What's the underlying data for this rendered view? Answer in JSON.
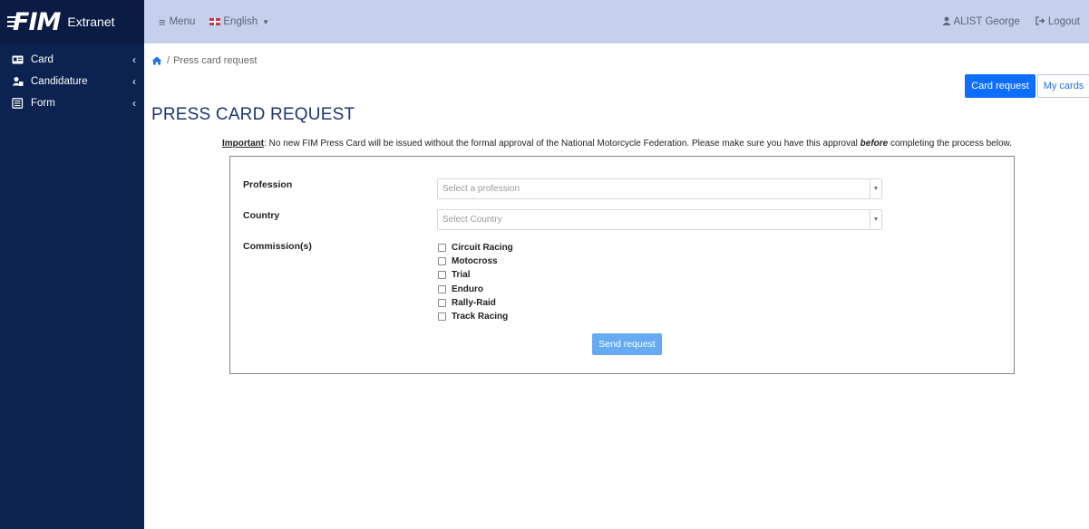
{
  "brand": {
    "logo": "FIM",
    "name": "Extranet"
  },
  "sidebar": {
    "items": [
      {
        "label": "Card",
        "icon": "id-card-icon"
      },
      {
        "label": "Candidature",
        "icon": "user-card-icon"
      },
      {
        "label": "Form",
        "icon": "form-list-icon"
      }
    ]
  },
  "topbar": {
    "menu_label": "Menu",
    "language_label": "English",
    "user_name": "ALIST George",
    "logout_label": "Logout"
  },
  "breadcrumb": {
    "separator": "/",
    "current": "Press card request"
  },
  "actions": {
    "card_request": "Card request",
    "my_cards": "My cards"
  },
  "page": {
    "title": "PRESS CARD REQUEST"
  },
  "notice": {
    "important": "Important",
    "text_before": ": No new FIM Press Card will be issued without the formal approval of the National Motorcycle Federation. Please make sure you have this approval ",
    "emphasis": "before",
    "text_after": " completing the process below."
  },
  "form": {
    "profession": {
      "label": "Profession",
      "placeholder": "Select a profession"
    },
    "country": {
      "label": "Country",
      "placeholder": "Select Country"
    },
    "commissions": {
      "label": "Commission(s)",
      "options": [
        "Circuit Racing",
        "Motocross",
        "Trial",
        "Enduro",
        "Rally-Raid",
        "Track Racing"
      ]
    },
    "submit_label": "Send request"
  },
  "colors": {
    "sidebar": "#0c2251",
    "topbar": "#c5d1ec",
    "primary": "#0d6efd",
    "send_button": "#66aaf2",
    "title": "#1e3570"
  }
}
